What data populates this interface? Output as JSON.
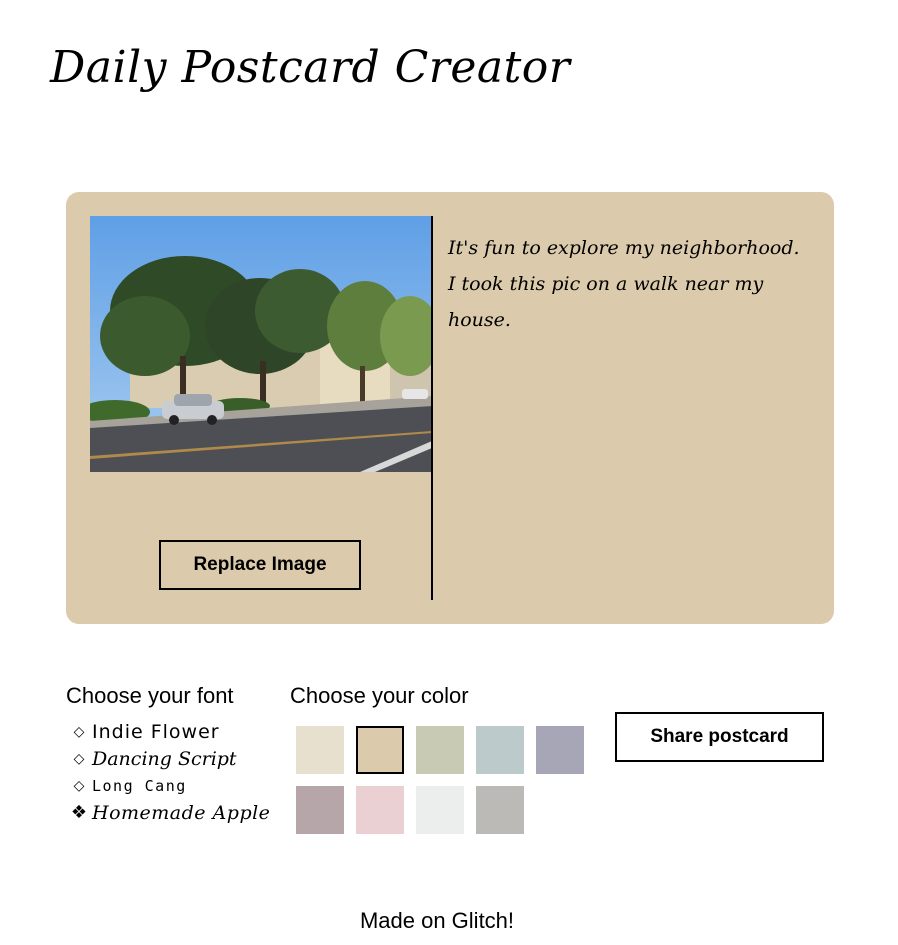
{
  "header": {
    "title": "Daily Postcard Creator"
  },
  "postcard": {
    "background_color": "#dbcaab",
    "message": "It's fun to explore my neighborhood. I took this pic on a walk near my house.",
    "replace_image_label": "Replace Image",
    "image": {
      "description_icon": "street-photo"
    }
  },
  "font_picker": {
    "heading": "Choose your font",
    "options": [
      {
        "label": "Indie Flower",
        "selected": false,
        "marker": "◇"
      },
      {
        "label": "Dancing Script",
        "selected": false,
        "marker": "◇"
      },
      {
        "label": "Long Cang",
        "selected": false,
        "marker": "◇"
      },
      {
        "label": "Homemade Apple",
        "selected": true,
        "marker": "❖"
      }
    ]
  },
  "color_picker": {
    "heading": "Choose your color",
    "swatches": [
      {
        "color": "#e8e0ce",
        "selected": false
      },
      {
        "color": "#dbcaab",
        "selected": true
      },
      {
        "color": "#c9cab4",
        "selected": false
      },
      {
        "color": "#bccacb",
        "selected": false
      },
      {
        "color": "#a7a6b6",
        "selected": false
      },
      {
        "color": "#b6a6aa",
        "selected": false
      },
      {
        "color": "#ebd0d3",
        "selected": false
      },
      {
        "color": "#ebeeec",
        "selected": false
      },
      {
        "color": "#bbbab7",
        "selected": false
      }
    ]
  },
  "actions": {
    "share_label": "Share postcard"
  },
  "footer": {
    "text": "Made on Glitch!"
  }
}
